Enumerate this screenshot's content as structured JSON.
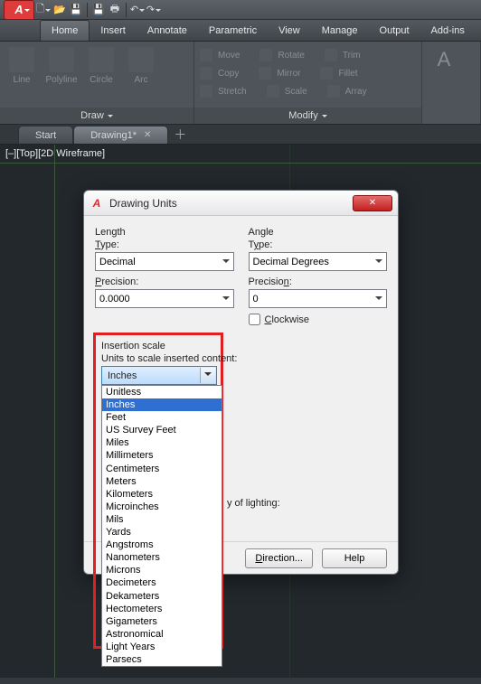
{
  "quick_access": {
    "icons": [
      "new",
      "open",
      "save",
      "save-as",
      "plot",
      "undo",
      "redo"
    ]
  },
  "menubar": {
    "tabs": [
      "Home",
      "Insert",
      "Annotate",
      "Parametric",
      "View",
      "Manage",
      "Output",
      "Add-ins"
    ],
    "active": "Home"
  },
  "ribbon": {
    "draw": {
      "title": "Draw",
      "items": [
        "Line",
        "Polyline",
        "Circle",
        "Arc"
      ]
    },
    "modify": {
      "title": "Modify",
      "rows": [
        [
          "Move",
          "Rotate",
          "Trim"
        ],
        [
          "Copy",
          "Mirror",
          "Fillet"
        ],
        [
          "Stretch",
          "Scale",
          "Array"
        ]
      ]
    }
  },
  "doc_tabs": {
    "tabs": [
      {
        "label": "Start",
        "active": false,
        "closable": false
      },
      {
        "label": "Drawing1*",
        "active": true,
        "closable": true
      }
    ]
  },
  "viewport_label": "[–][Top][2D Wireframe]",
  "dialog": {
    "title": "Drawing Units",
    "length_section": "Length",
    "angle_section": "Angle",
    "type_label": "Type:",
    "precision_label": "Precision:",
    "length_type": "Decimal",
    "angle_type": "Decimal Degrees",
    "length_precision": "0.0000",
    "angle_precision": "0",
    "clockwise_label": "Clockwise",
    "insertion_head": "Insertion scale",
    "insertion_label": "Units to scale inserted content:",
    "insertion_value": "Inches",
    "units_options": [
      "Unitless",
      "Inches",
      "Feet",
      "US Survey Feet",
      "Miles",
      "Millimeters",
      "Centimeters",
      "Meters",
      "Kilometers",
      "Microinches",
      "Mils",
      "Yards",
      "Angstroms",
      "Nanometers",
      "Microns",
      "Decimeters",
      "Dekameters",
      "Hectometers",
      "Gigameters",
      "Astronomical",
      "Light Years",
      "Parsecs"
    ],
    "units_selected": "Inches",
    "lighting_hint": "y of lighting:",
    "buttons": {
      "direction": "Direction...",
      "help": "Help"
    }
  }
}
